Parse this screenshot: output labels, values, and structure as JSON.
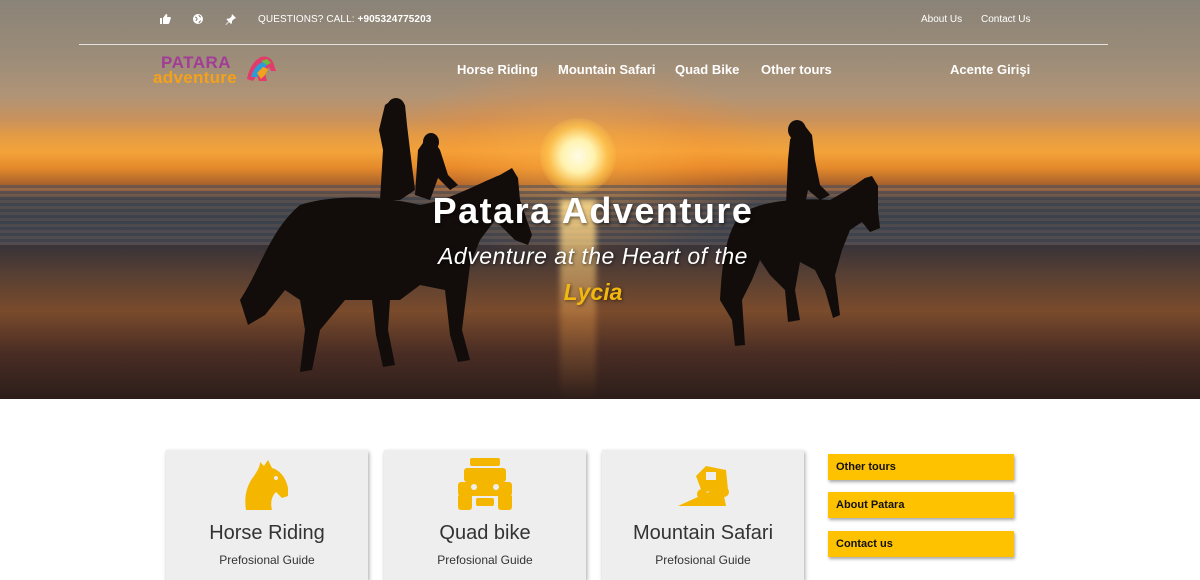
{
  "topbar": {
    "icons": [
      "thumbs-up-icon",
      "globe-icon",
      "pin-icon"
    ],
    "questions_label": "QUESTIONS? CALL:",
    "phone": "+905324775203",
    "links": [
      "About Us",
      "Contact Us"
    ]
  },
  "brand": {
    "logo_line1": "PATARA",
    "logo_line2": "adventure"
  },
  "nav": {
    "items": [
      "Horse Riding",
      "Mountain Safari",
      "Quad Bike",
      "Other tours"
    ],
    "agent_login": "Acente Girişi"
  },
  "hero": {
    "title": "Patara Adventure",
    "subtitle_line1": "Adventure at the Heart of the",
    "subtitle_line2": "Lycia"
  },
  "cards": [
    {
      "icon": "horse-head-icon",
      "title": "Horse Riding",
      "subtitle": "Prefosional Guide"
    },
    {
      "icon": "quad-bike-icon",
      "title": "Quad bike",
      "subtitle": "Prefosional Guide"
    },
    {
      "icon": "jeep-icon",
      "title": "Mountain Safari",
      "subtitle": "Prefosional Guide"
    }
  ],
  "sidebar": {
    "buttons": [
      "Other tours",
      "About Patara",
      "Contact us"
    ]
  },
  "colors": {
    "accent_yellow": "#ffc200",
    "icon_orange": "#f5b600",
    "logo_purple": "#a23c98",
    "logo_orange": "#f4a11b"
  }
}
